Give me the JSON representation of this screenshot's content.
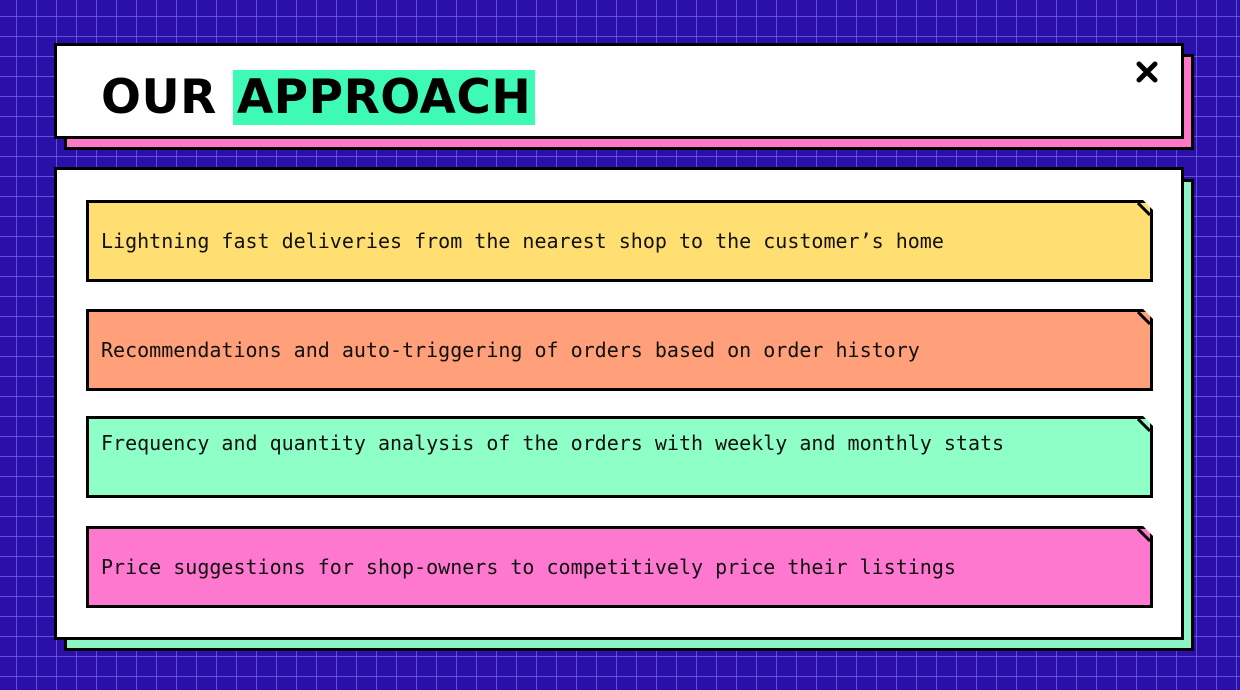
{
  "header": {
    "title_word1": "OUR",
    "title_word2": "APPROACH",
    "highlight_color": "#3dfbb5",
    "close_icon": "close-icon"
  },
  "items": [
    {
      "text": "Lightning fast deliveries from the nearest shop to the customer’s home",
      "color": "#ffde72"
    },
    {
      "text": "Recommendations and auto-triggering of orders based on order history",
      "color": "#ffa07a"
    },
    {
      "text": "Frequency and quantity analysis of the orders with weekly and monthly stats",
      "color": "#8effc6"
    },
    {
      "text": "Price suggestions for shop-owners to competitively price their listings",
      "color": "#ff78d0"
    }
  ],
  "colors": {
    "background": "#2a0fa8",
    "title_shadow": "#ff78c8",
    "content_shadow": "#8df5c4"
  }
}
